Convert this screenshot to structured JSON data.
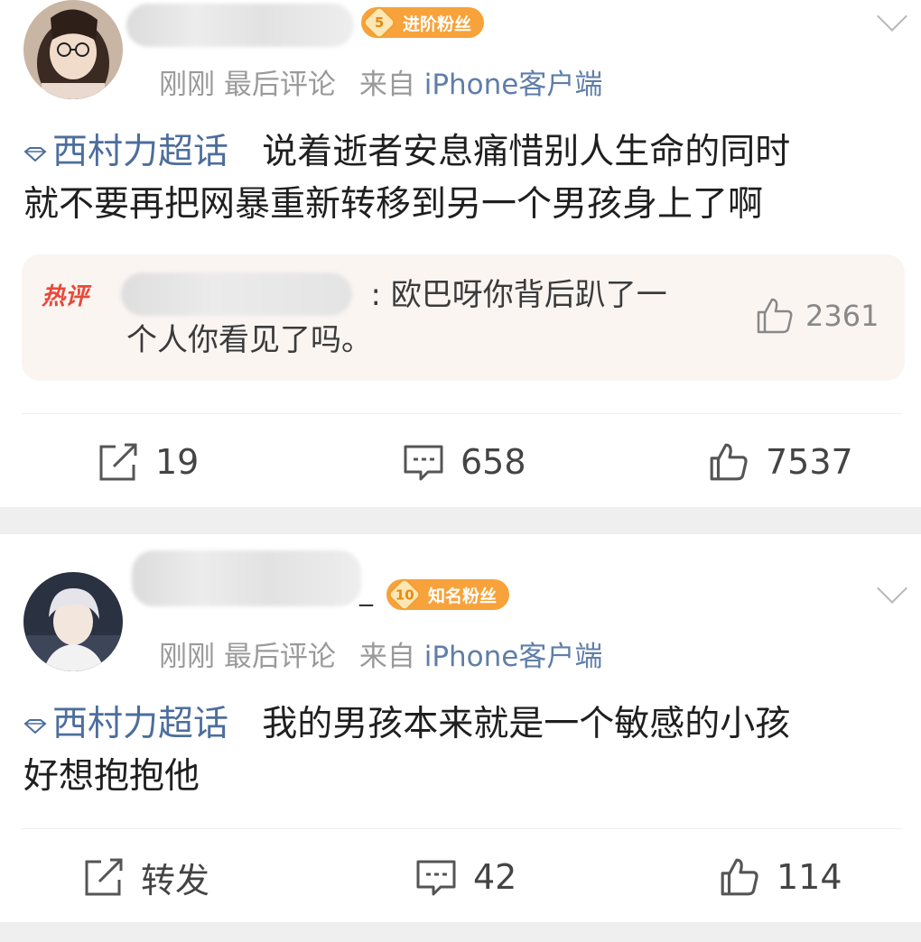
{
  "posts": [
    {
      "level": "5",
      "fan_badge": "进阶粉丝",
      "time": "刚刚",
      "action": "最后评论",
      "source_prefix": "来自",
      "source": "iPhone客户端",
      "topic": "西村力超话",
      "text_line1": "说着逝者安息痛惜别人生命的同时",
      "text_line2": "就不要再把网暴重新转移到另一个男孩身上了啊",
      "hot_comment": {
        "label": "热评",
        "colon": ":",
        "text_line1": "欧巴呀你背后趴了一",
        "text_line2": "个人你看见了吗。",
        "likes": "2361"
      },
      "reposts": "19",
      "comments": "658",
      "likes": "7537"
    },
    {
      "level": "10",
      "fan_badge": "知名粉丝",
      "name_suffix": "_",
      "time": "刚刚",
      "action": "最后评论",
      "source_prefix": "来自",
      "source": "iPhone客户端",
      "topic": "西村力超话",
      "text_line1": "我的男孩本来就是一个敏感的小孩",
      "text_line2": "好想抱抱他",
      "reposts": "转发",
      "comments": "42",
      "likes": "114"
    }
  ],
  "colors": {
    "topic": "#4c6e9c",
    "badge": "#f7a23a",
    "hot_label": "#e8483a",
    "separator": "#efefef"
  },
  "icons": [
    "repost-icon",
    "comment-icon",
    "like-icon",
    "chevron-down-icon",
    "topic-diamond-icon"
  ]
}
